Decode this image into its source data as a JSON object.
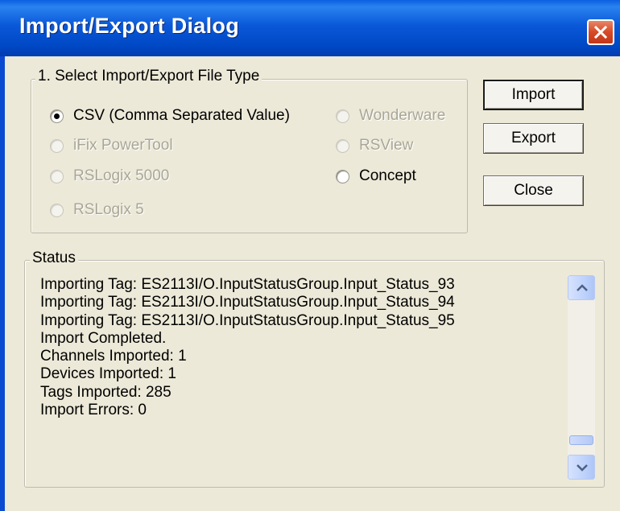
{
  "window": {
    "title": "Import/Export Dialog"
  },
  "file_type_group": {
    "legend": "1. Select Import/Export File Type",
    "options": [
      {
        "label": "CSV (Comma Separated Value)",
        "selected": true,
        "enabled": true
      },
      {
        "label": "iFix PowerTool",
        "selected": false,
        "enabled": false
      },
      {
        "label": "RSLogix 5000",
        "selected": false,
        "enabled": false
      },
      {
        "label": "RSLogix 5",
        "selected": false,
        "enabled": false
      },
      {
        "label": "Wonderware",
        "selected": false,
        "enabled": false
      },
      {
        "label": "RSView",
        "selected": false,
        "enabled": false
      },
      {
        "label": "Concept",
        "selected": false,
        "enabled": true
      }
    ]
  },
  "buttons": {
    "import": "Import",
    "export": "Export",
    "close": "Close"
  },
  "status": {
    "legend": "Status",
    "lines": [
      "Importing Tag: ES2113I/O.InputStatusGroup.Input_Status_93",
      "Importing Tag: ES2113I/O.InputStatusGroup.Input_Status_94",
      "Importing Tag: ES2113I/O.InputStatusGroup.Input_Status_95",
      "Import Completed.",
      "Channels Imported: 1",
      "Devices Imported: 1",
      "Tags Imported: 285",
      "Import Errors: 0"
    ]
  },
  "colors": {
    "title_bar": "#0a58d8",
    "dialog_face": "#ece9d8",
    "close_button": "#d64a26",
    "scrollbar_button": "#bfd2fb"
  },
  "icons": {
    "close": "close-x-icon",
    "scroll_up": "chevron-up-icon",
    "scroll_down": "chevron-down-icon"
  }
}
